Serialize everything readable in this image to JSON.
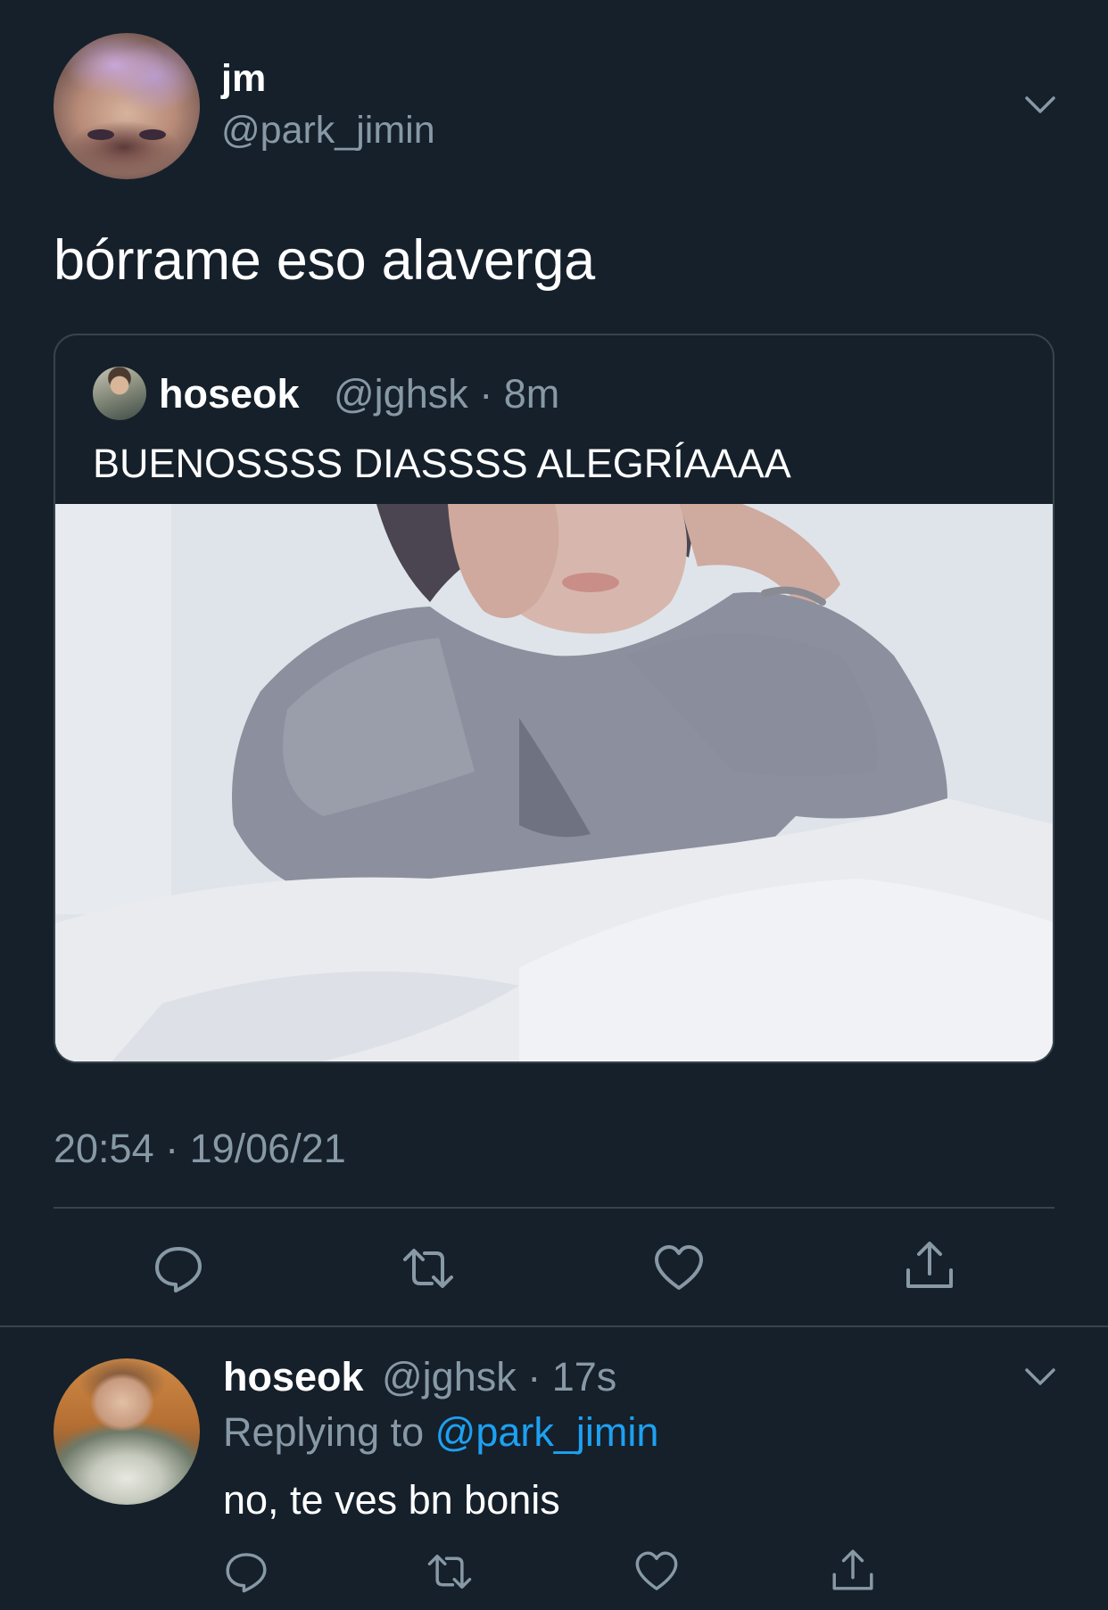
{
  "main_tweet": {
    "display_name": "jm",
    "handle": "@park_jimin",
    "text": "bórrame eso alaverga",
    "timestamp": "20:54 · 19/06/21",
    "menu_icon": "chevron-down-icon"
  },
  "quoted_tweet": {
    "display_name": "hoseok",
    "handle_time": "@jghsk · 8m",
    "text": "BUENOSSSS DIASSSS ALEGRÍAAAA"
  },
  "actions": {
    "icons": [
      "reply-icon",
      "retweet-icon",
      "like-icon",
      "share-icon"
    ]
  },
  "reply": {
    "display_name": "hoseok",
    "handle_time": "@jghsk · 17s",
    "replying_prefix": "Replying to",
    "replying_mention": "@park_jimin",
    "text": "no, te ves bn bonis",
    "menu_icon": "chevron-down-icon"
  },
  "colors": {
    "background": "#15202b",
    "secondary_text": "#8899a6",
    "border": "#38444d",
    "link": "#1da1f2"
  }
}
